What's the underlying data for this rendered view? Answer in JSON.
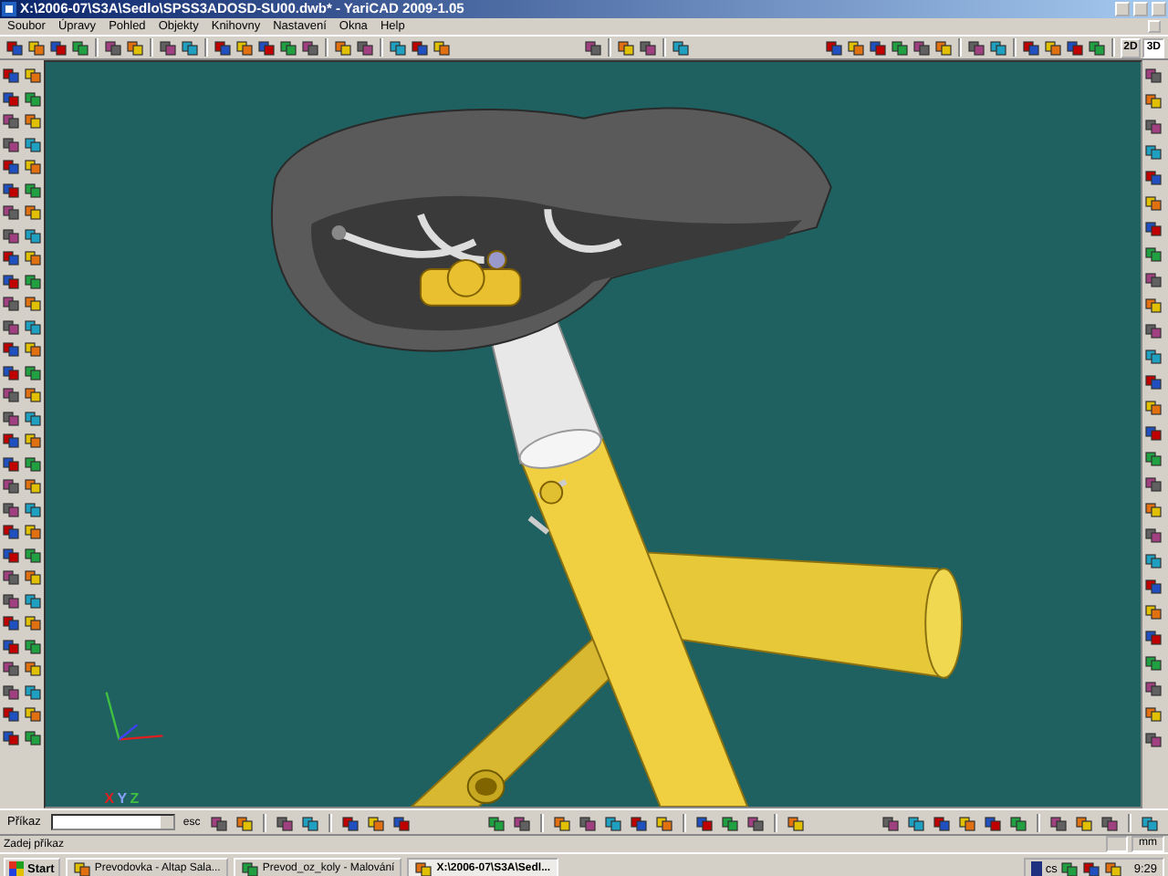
{
  "window": {
    "title": "X:\\2006-07\\S3A\\Sedlo\\SPSS3ADOSD-SU00.dwb* - YariCAD 2009-1.05"
  },
  "menu": [
    "Soubor",
    "Úpravy",
    "Pohled",
    "Objekty",
    "Knihovny",
    "Nastavení",
    "Okna",
    "Help"
  ],
  "view_modes": [
    {
      "label": "2D",
      "selected": false
    },
    {
      "label": "3D",
      "selected": true
    }
  ],
  "viewport": {
    "axis_labels": [
      "X",
      "Y",
      "Z"
    ]
  },
  "command_bar": {
    "label": "Příkaz",
    "escape": "esc"
  },
  "status_bar": {
    "prompt": "Zadej příkaz",
    "units": "mm"
  },
  "taskbar": {
    "start": "Start",
    "tasks": [
      {
        "label": "Prevodovka - Altap Sala...",
        "selected": false
      },
      {
        "label": "Prevod_oz_koly - Malování",
        "selected": false
      },
      {
        "label": "X:\\2006-07\\S3A\\Sedl...",
        "selected": true
      }
    ],
    "tray_label": "cs",
    "clock": "9:29"
  }
}
